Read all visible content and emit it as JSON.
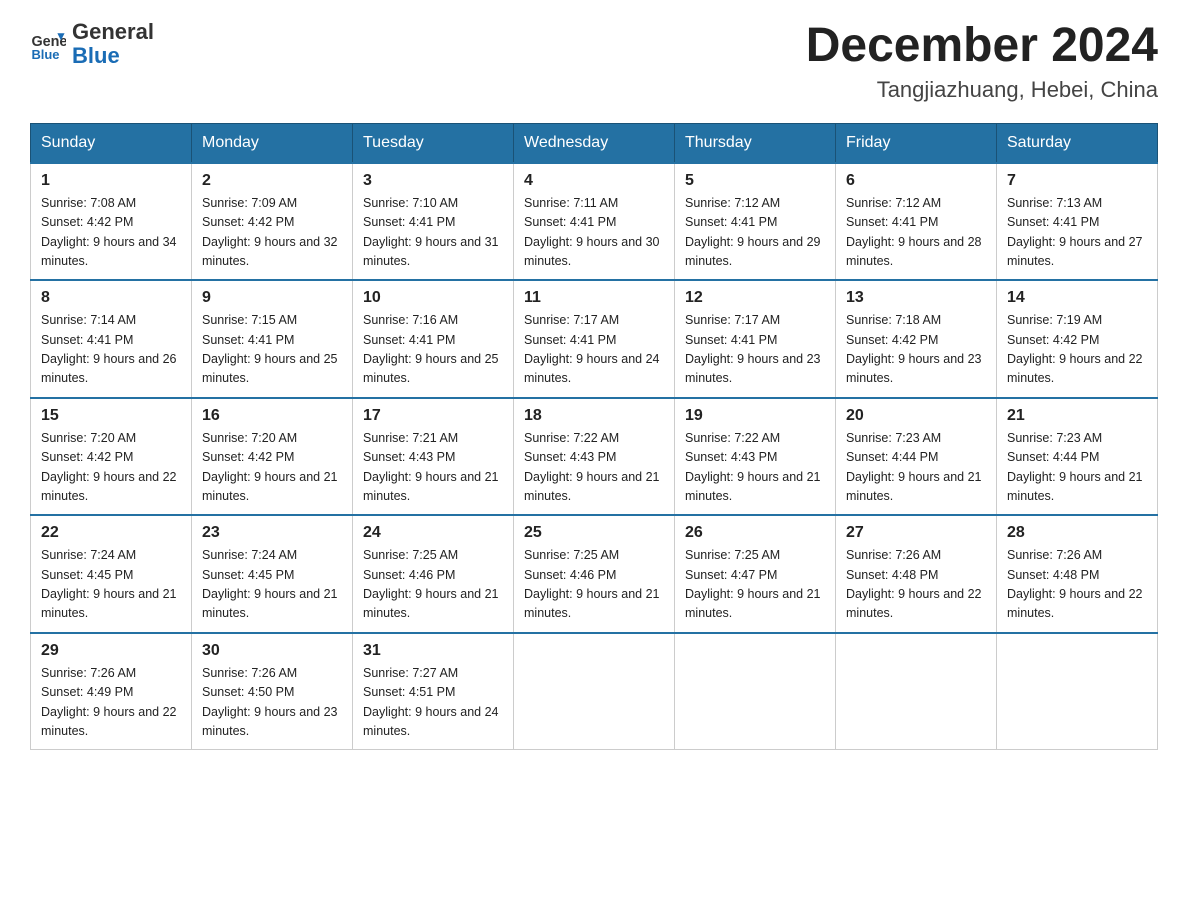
{
  "header": {
    "logo_general": "General",
    "logo_blue": "Blue",
    "month": "December 2024",
    "location": "Tangjiazhuang, Hebei, China"
  },
  "weekdays": [
    "Sunday",
    "Monday",
    "Tuesday",
    "Wednesday",
    "Thursday",
    "Friday",
    "Saturday"
  ],
  "weeks": [
    [
      {
        "day": "1",
        "sunrise": "7:08 AM",
        "sunset": "4:42 PM",
        "daylight": "9 hours and 34 minutes."
      },
      {
        "day": "2",
        "sunrise": "7:09 AM",
        "sunset": "4:42 PM",
        "daylight": "9 hours and 32 minutes."
      },
      {
        "day": "3",
        "sunrise": "7:10 AM",
        "sunset": "4:41 PM",
        "daylight": "9 hours and 31 minutes."
      },
      {
        "day": "4",
        "sunrise": "7:11 AM",
        "sunset": "4:41 PM",
        "daylight": "9 hours and 30 minutes."
      },
      {
        "day": "5",
        "sunrise": "7:12 AM",
        "sunset": "4:41 PM",
        "daylight": "9 hours and 29 minutes."
      },
      {
        "day": "6",
        "sunrise": "7:12 AM",
        "sunset": "4:41 PM",
        "daylight": "9 hours and 28 minutes."
      },
      {
        "day": "7",
        "sunrise": "7:13 AM",
        "sunset": "4:41 PM",
        "daylight": "9 hours and 27 minutes."
      }
    ],
    [
      {
        "day": "8",
        "sunrise": "7:14 AM",
        "sunset": "4:41 PM",
        "daylight": "9 hours and 26 minutes."
      },
      {
        "day": "9",
        "sunrise": "7:15 AM",
        "sunset": "4:41 PM",
        "daylight": "9 hours and 25 minutes."
      },
      {
        "day": "10",
        "sunrise": "7:16 AM",
        "sunset": "4:41 PM",
        "daylight": "9 hours and 25 minutes."
      },
      {
        "day": "11",
        "sunrise": "7:17 AM",
        "sunset": "4:41 PM",
        "daylight": "9 hours and 24 minutes."
      },
      {
        "day": "12",
        "sunrise": "7:17 AM",
        "sunset": "4:41 PM",
        "daylight": "9 hours and 23 minutes."
      },
      {
        "day": "13",
        "sunrise": "7:18 AM",
        "sunset": "4:42 PM",
        "daylight": "9 hours and 23 minutes."
      },
      {
        "day": "14",
        "sunrise": "7:19 AM",
        "sunset": "4:42 PM",
        "daylight": "9 hours and 22 minutes."
      }
    ],
    [
      {
        "day": "15",
        "sunrise": "7:20 AM",
        "sunset": "4:42 PM",
        "daylight": "9 hours and 22 minutes."
      },
      {
        "day": "16",
        "sunrise": "7:20 AM",
        "sunset": "4:42 PM",
        "daylight": "9 hours and 21 minutes."
      },
      {
        "day": "17",
        "sunrise": "7:21 AM",
        "sunset": "4:43 PM",
        "daylight": "9 hours and 21 minutes."
      },
      {
        "day": "18",
        "sunrise": "7:22 AM",
        "sunset": "4:43 PM",
        "daylight": "9 hours and 21 minutes."
      },
      {
        "day": "19",
        "sunrise": "7:22 AM",
        "sunset": "4:43 PM",
        "daylight": "9 hours and 21 minutes."
      },
      {
        "day": "20",
        "sunrise": "7:23 AM",
        "sunset": "4:44 PM",
        "daylight": "9 hours and 21 minutes."
      },
      {
        "day": "21",
        "sunrise": "7:23 AM",
        "sunset": "4:44 PM",
        "daylight": "9 hours and 21 minutes."
      }
    ],
    [
      {
        "day": "22",
        "sunrise": "7:24 AM",
        "sunset": "4:45 PM",
        "daylight": "9 hours and 21 minutes."
      },
      {
        "day": "23",
        "sunrise": "7:24 AM",
        "sunset": "4:45 PM",
        "daylight": "9 hours and 21 minutes."
      },
      {
        "day": "24",
        "sunrise": "7:25 AM",
        "sunset": "4:46 PM",
        "daylight": "9 hours and 21 minutes."
      },
      {
        "day": "25",
        "sunrise": "7:25 AM",
        "sunset": "4:46 PM",
        "daylight": "9 hours and 21 minutes."
      },
      {
        "day": "26",
        "sunrise": "7:25 AM",
        "sunset": "4:47 PM",
        "daylight": "9 hours and 21 minutes."
      },
      {
        "day": "27",
        "sunrise": "7:26 AM",
        "sunset": "4:48 PM",
        "daylight": "9 hours and 22 minutes."
      },
      {
        "day": "28",
        "sunrise": "7:26 AM",
        "sunset": "4:48 PM",
        "daylight": "9 hours and 22 minutes."
      }
    ],
    [
      {
        "day": "29",
        "sunrise": "7:26 AM",
        "sunset": "4:49 PM",
        "daylight": "9 hours and 22 minutes."
      },
      {
        "day": "30",
        "sunrise": "7:26 AM",
        "sunset": "4:50 PM",
        "daylight": "9 hours and 23 minutes."
      },
      {
        "day": "31",
        "sunrise": "7:27 AM",
        "sunset": "4:51 PM",
        "daylight": "9 hours and 24 minutes."
      },
      null,
      null,
      null,
      null
    ]
  ]
}
